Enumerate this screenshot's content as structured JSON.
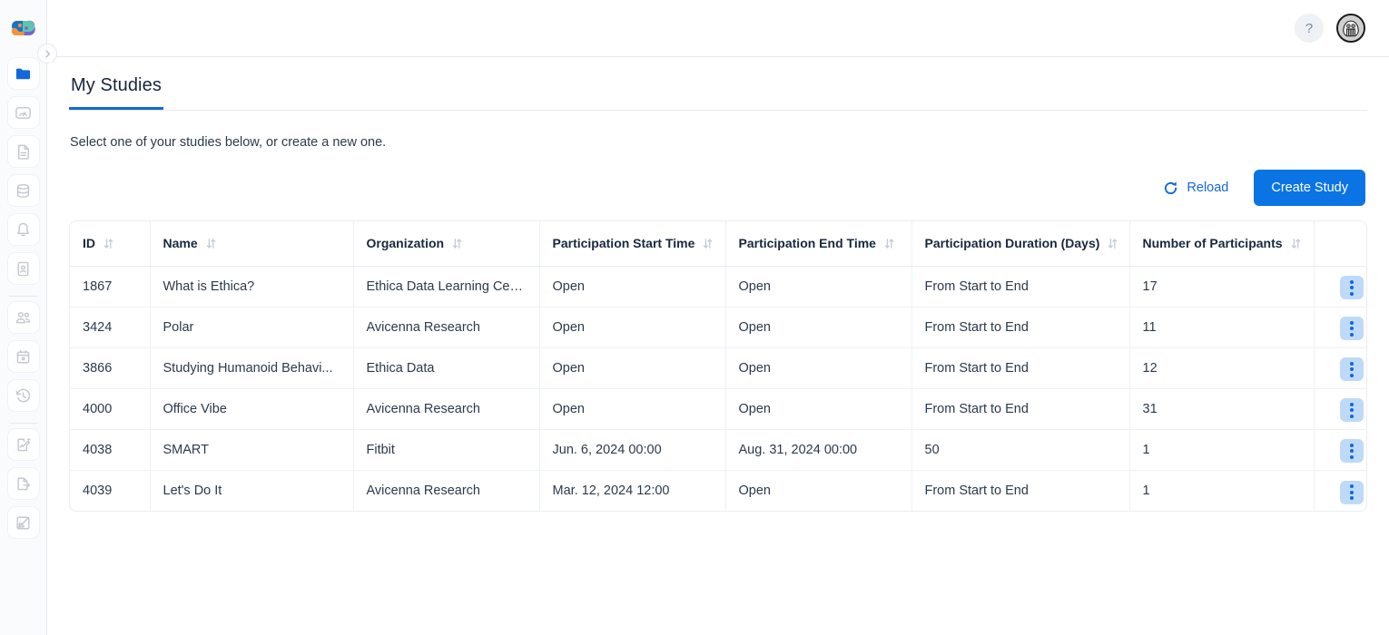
{
  "app": {
    "logo_name": "ethica-brain-logo"
  },
  "sidebar": {
    "collapse_toggle_label": "chevron-right",
    "groups": [
      {
        "items": [
          {
            "icon": "folder-icon",
            "label": "Studies",
            "active": true
          },
          {
            "icon": "dashboard-icon",
            "label": "Dashboard",
            "active": false
          },
          {
            "icon": "document-icon",
            "label": "Surveys",
            "active": false
          },
          {
            "icon": "database-icon",
            "label": "Data",
            "active": false
          },
          {
            "icon": "bell-icon",
            "label": "Notifications",
            "active": false
          },
          {
            "icon": "id-card-icon",
            "label": "Profile",
            "active": false
          }
        ]
      },
      {
        "items": [
          {
            "icon": "people-icon",
            "label": "Participants",
            "active": false
          },
          {
            "icon": "calendar-icon",
            "label": "Schedule",
            "active": false
          },
          {
            "icon": "history-clock-icon",
            "label": "History",
            "active": false
          }
        ]
      },
      {
        "items": [
          {
            "icon": "edit-document-icon",
            "label": "Compose",
            "active": false
          },
          {
            "icon": "export-document-icon",
            "label": "Export",
            "active": false
          },
          {
            "icon": "chart-area-icon",
            "label": "Reports",
            "active": false
          }
        ]
      }
    ]
  },
  "header": {
    "help_label": "?",
    "avatar_label": "user-avatar"
  },
  "page": {
    "tabs": [
      {
        "label": "My Studies",
        "active": true
      }
    ],
    "subtitle": "Select one of your studies below, or create a new one."
  },
  "toolbar": {
    "reload_label": "Reload",
    "create_label": "Create Study"
  },
  "table": {
    "columns": [
      {
        "label": "ID",
        "sortable": true
      },
      {
        "label": "Name",
        "sortable": true
      },
      {
        "label": "Organization",
        "sortable": true
      },
      {
        "label": "Participation Start Time",
        "sortable": true
      },
      {
        "label": "Participation End Time",
        "sortable": true
      },
      {
        "label": "Participation Duration (Days)",
        "sortable": true
      },
      {
        "label": "Number of Participants",
        "sortable": true
      },
      {
        "label": "",
        "sortable": false
      }
    ],
    "rows": [
      {
        "id": "1867",
        "name": "What is Ethica?",
        "organization": "Ethica Data Learning Center",
        "start_time": "Open",
        "end_time": "Open",
        "duration": "From Start to End",
        "participants": "17",
        "action": "row-menu"
      },
      {
        "id": "3424",
        "name": "Polar",
        "organization": "Avicenna Research",
        "start_time": "Open",
        "end_time": "Open",
        "duration": "From Start to End",
        "participants": "11",
        "action": "row-menu"
      },
      {
        "id": "3866",
        "name": "Studying Humanoid Behavi...",
        "organization": "Ethica Data",
        "start_time": "Open",
        "end_time": "Open",
        "duration": "From Start to End",
        "participants": "12",
        "action": "row-menu"
      },
      {
        "id": "4000",
        "name": "Office Vibe",
        "organization": "Avicenna Research",
        "start_time": "Open",
        "end_time": "Open",
        "duration": "From Start to End",
        "participants": "31",
        "action": "row-menu"
      },
      {
        "id": "4038",
        "name": "SMART",
        "organization": "Fitbit",
        "start_time": "Jun. 6, 2024 00:00",
        "end_time": "Aug. 31, 2024 00:00",
        "duration": "50",
        "participants": "1",
        "action": "row-menu"
      },
      {
        "id": "4039",
        "name": "Let's Do It",
        "organization": "Avicenna Research",
        "start_time": "Mar. 12, 2024 12:00",
        "end_time": "Open",
        "duration": "From Start to End",
        "participants": "1",
        "action": "row-menu"
      }
    ]
  },
  "colors": {
    "accent": "#0b74e5",
    "link": "#1268d9",
    "text": "#2b3a4c",
    "heading": "#17263a",
    "border": "#e9edf2",
    "kebab_bg": "#bedaf8"
  }
}
